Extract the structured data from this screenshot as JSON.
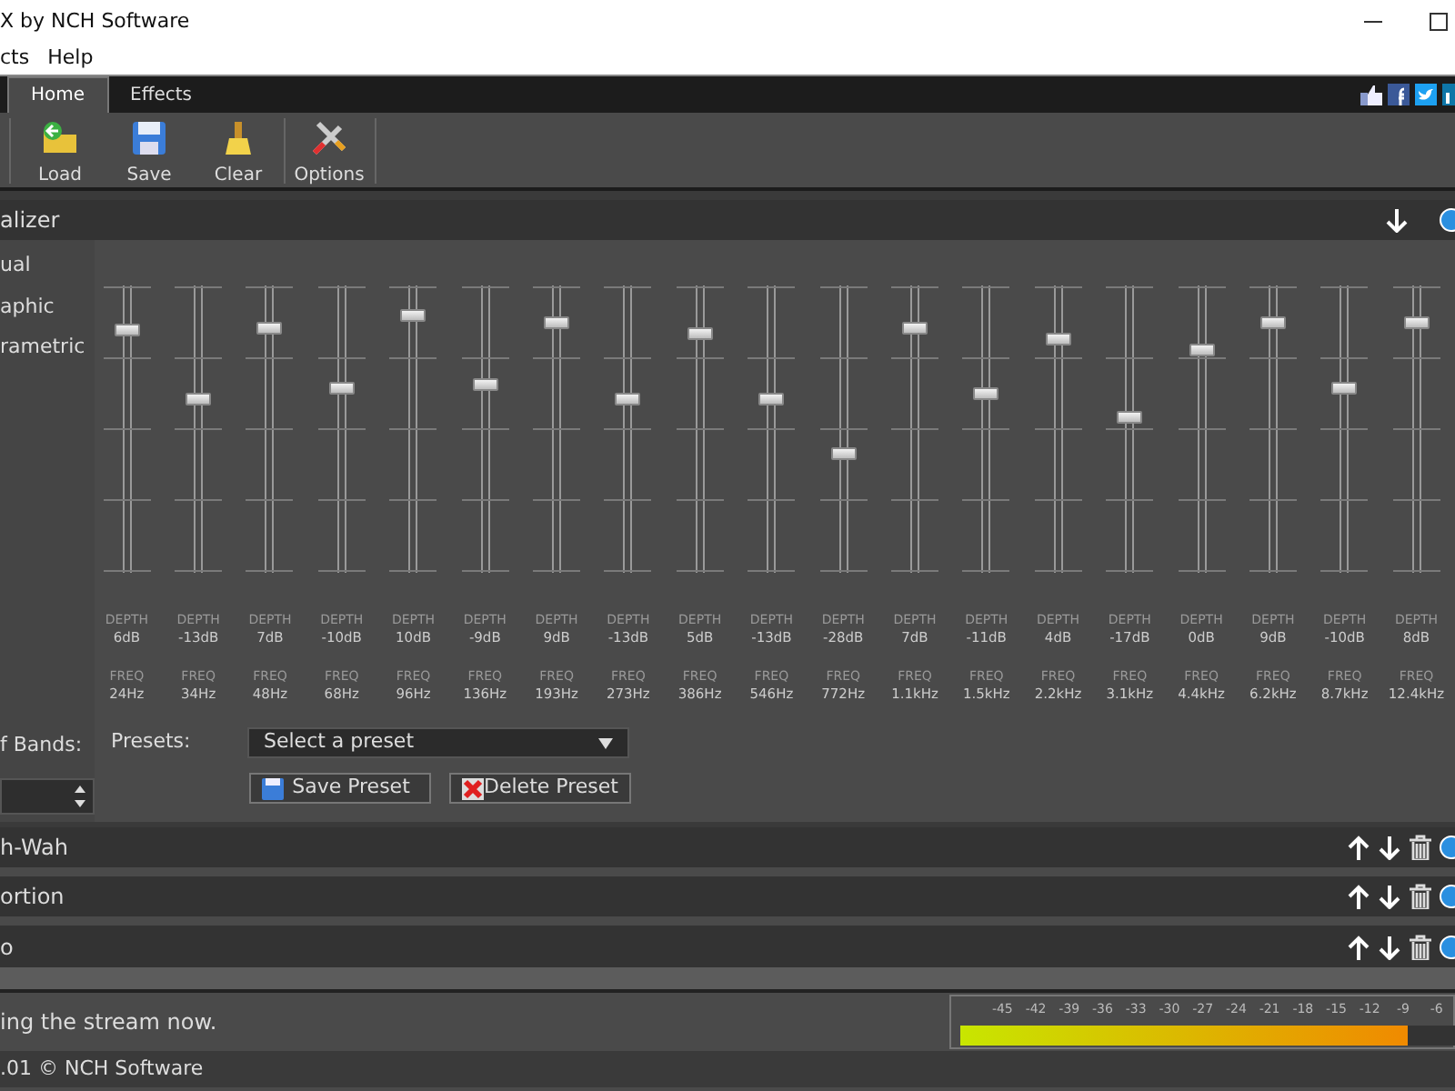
{
  "window": {
    "title": "X by NCH Software"
  },
  "menu": [
    {
      "label": "cts"
    },
    {
      "label": "Help"
    }
  ],
  "tabs": [
    {
      "label": "Home",
      "selected": true
    },
    {
      "label": "Effects",
      "selected": false
    }
  ],
  "toolbar": [
    {
      "label": "Load",
      "kind": "load"
    },
    {
      "label": "Save",
      "kind": "save"
    },
    {
      "label": "Clear",
      "kind": "clear"
    },
    {
      "label": "Options",
      "kind": "options"
    }
  ],
  "equalizer": {
    "title": "alizer",
    "modes": [
      {
        "label": "ual"
      },
      {
        "label": "aphic"
      },
      {
        "label": "rametric"
      }
    ],
    "bands": [
      {
        "depth_label": "DEPTH",
        "depth": "6dB",
        "freq_label": "FREQ",
        "freq": "24Hz",
        "level": 0.84
      },
      {
        "depth_label": "DEPTH",
        "depth": "-13dB",
        "freq_label": "FREQ",
        "freq": "34Hz",
        "level": 0.6
      },
      {
        "depth_label": "DEPTH",
        "depth": "7dB",
        "freq_label": "FREQ",
        "freq": "48Hz",
        "level": 0.85
      },
      {
        "depth_label": "DEPTH",
        "depth": "-10dB",
        "freq_label": "FREQ",
        "freq": "68Hz",
        "level": 0.64
      },
      {
        "depth_label": "DEPTH",
        "depth": "10dB",
        "freq_label": "FREQ",
        "freq": "96Hz",
        "level": 0.89
      },
      {
        "depth_label": "DEPTH",
        "depth": "-9dB",
        "freq_label": "FREQ",
        "freq": "136Hz",
        "level": 0.65
      },
      {
        "depth_label": "DEPTH",
        "depth": "9dB",
        "freq_label": "FREQ",
        "freq": "193Hz",
        "level": 0.87
      },
      {
        "depth_label": "DEPTH",
        "depth": "-13dB",
        "freq_label": "FREQ",
        "freq": "273Hz",
        "level": 0.6
      },
      {
        "depth_label": "DEPTH",
        "depth": "5dB",
        "freq_label": "FREQ",
        "freq": "386Hz",
        "level": 0.83
      },
      {
        "depth_label": "DEPTH",
        "depth": "-13dB",
        "freq_label": "FREQ",
        "freq": "546Hz",
        "level": 0.6
      },
      {
        "depth_label": "DEPTH",
        "depth": "-28dB",
        "freq_label": "FREQ",
        "freq": "772Hz",
        "level": 0.41
      },
      {
        "depth_label": "DEPTH",
        "depth": "7dB",
        "freq_label": "FREQ",
        "freq": "1.1kHz",
        "level": 0.85
      },
      {
        "depth_label": "DEPTH",
        "depth": "-11dB",
        "freq_label": "FREQ",
        "freq": "1.5kHz",
        "level": 0.62
      },
      {
        "depth_label": "DEPTH",
        "depth": "4dB",
        "freq_label": "FREQ",
        "freq": "2.2kHz",
        "level": 0.81
      },
      {
        "depth_label": "DEPTH",
        "depth": "-17dB",
        "freq_label": "FREQ",
        "freq": "3.1kHz",
        "level": 0.54
      },
      {
        "depth_label": "DEPTH",
        "depth": "0dB",
        "freq_label": "FREQ",
        "freq": "4.4kHz",
        "level": 0.77
      },
      {
        "depth_label": "DEPTH",
        "depth": "9dB",
        "freq_label": "FREQ",
        "freq": "6.2kHz",
        "level": 0.87
      },
      {
        "depth_label": "DEPTH",
        "depth": "-10dB",
        "freq_label": "FREQ",
        "freq": "8.7kHz",
        "level": 0.64
      },
      {
        "depth_label": "DEPTH",
        "depth": "8dB",
        "freq_label": "FREQ",
        "freq": "12.4kHz",
        "level": 0.87
      }
    ],
    "bands_label": "f Bands:",
    "presets_label": "Presets:",
    "preset_select": {
      "value": "Select a preset"
    },
    "buttons": [
      {
        "label": "Save Preset",
        "kind": "save"
      },
      {
        "label": "Delete Preset",
        "kind": "delete"
      }
    ]
  },
  "effects": [
    {
      "title": "h-Wah"
    },
    {
      "title": "ortion"
    },
    {
      "title": "o"
    }
  ],
  "status": {
    "message": "ing the stream now.",
    "meter": {
      "scale": [
        "-45",
        "-42",
        "-39",
        "-36",
        "-33",
        "-30",
        "-27",
        "-24",
        "-21",
        "-18",
        "-15",
        "-12",
        "-9",
        "-6"
      ],
      "level": 0.9
    }
  },
  "footer": ".01 © NCH Software"
}
